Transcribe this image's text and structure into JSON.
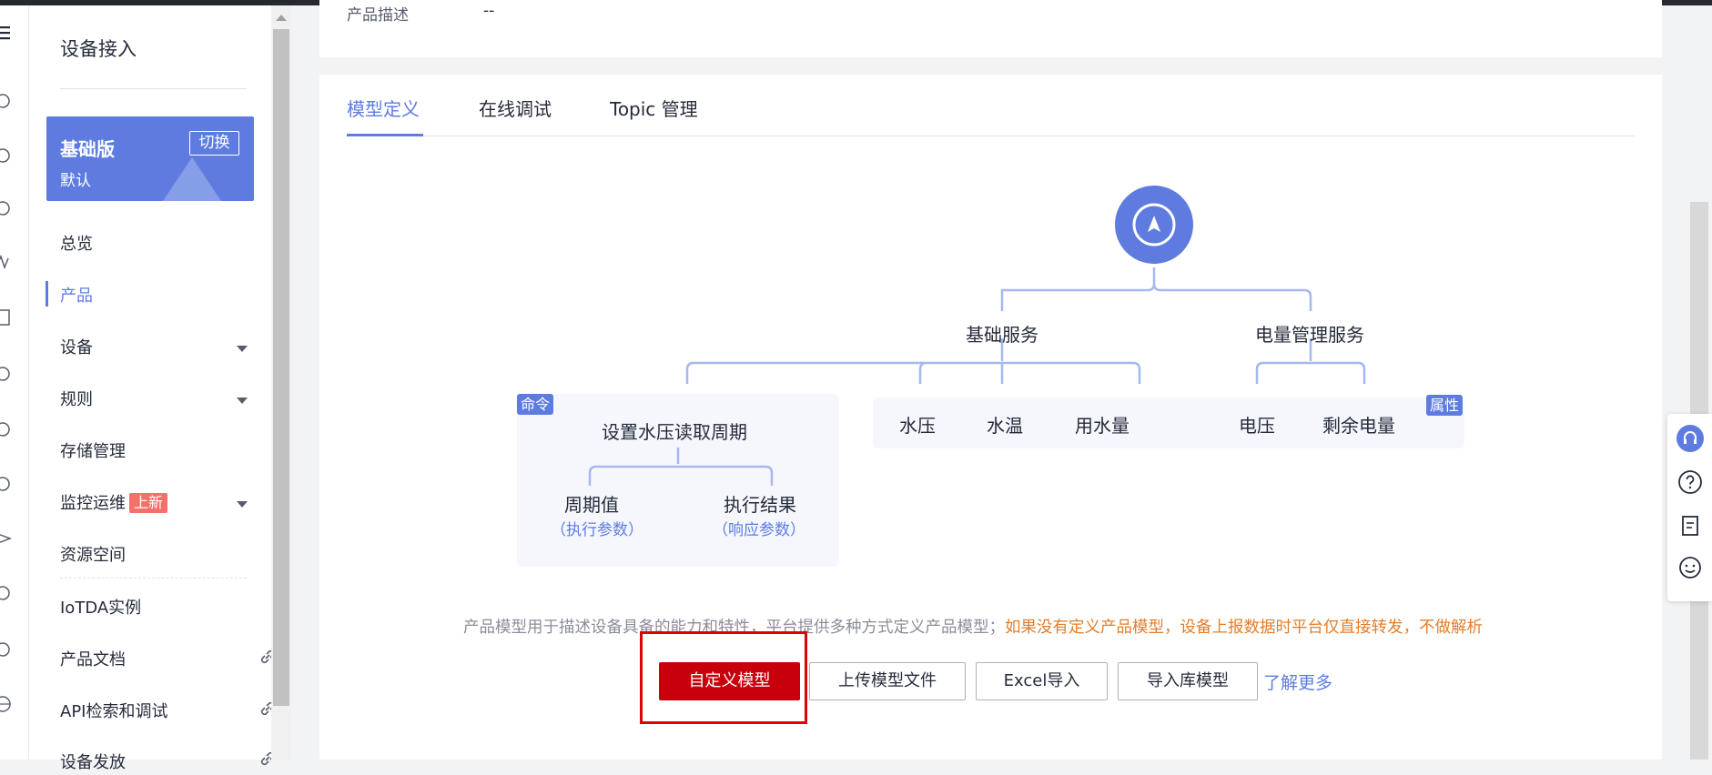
{
  "product_info": {
    "label": "产品描述",
    "value": "--"
  },
  "sidebar": {
    "title": "设备接入",
    "edition": {
      "name": "基础版",
      "sub": "默认",
      "switch_label": "切换"
    },
    "items": [
      {
        "label": "总览"
      },
      {
        "label": "产品"
      },
      {
        "label": "设备"
      },
      {
        "label": "规则"
      },
      {
        "label": "存储管理"
      },
      {
        "label": "监控运维",
        "badge": "上新"
      },
      {
        "label": "资源空间"
      },
      {
        "label": "IoTDA实例"
      },
      {
        "label": "产品文档"
      },
      {
        "label": "API检索和调试"
      },
      {
        "label": "设备发放"
      }
    ]
  },
  "tabs": [
    {
      "label": "模型定义"
    },
    {
      "label": "在线调试"
    },
    {
      "label": "Topic 管理"
    }
  ],
  "model_diagram": {
    "services": [
      "基础服务",
      "电量管理服务"
    ],
    "command_tag": "命令",
    "property_tag": "属性",
    "command": {
      "name": "设置水压读取周期",
      "param": {
        "name": "周期值",
        "type": "（执行参数）"
      },
      "response": {
        "name": "执行结果",
        "type": "（响应参数）"
      }
    },
    "properties": [
      "水压",
      "水温",
      "用水量",
      "电压",
      "剩余电量"
    ]
  },
  "description": {
    "text": "产品模型用于描述设备具备的能力和特性，平台提供多种方式定义产品模型；",
    "warning": "如果没有定义产品模型，设备上报数据时平台仅直接转发，不做解析"
  },
  "actions": {
    "custom_model": "自定义模型",
    "upload_model": "上传模型文件",
    "excel_import": "Excel导入",
    "import_library": "导入库模型",
    "learn_more": "了解更多"
  },
  "colors": {
    "accent": "#5e7ce0",
    "primary_button": "#c7000b",
    "warning": "#e37d29",
    "highlight_box": "#e00000"
  }
}
